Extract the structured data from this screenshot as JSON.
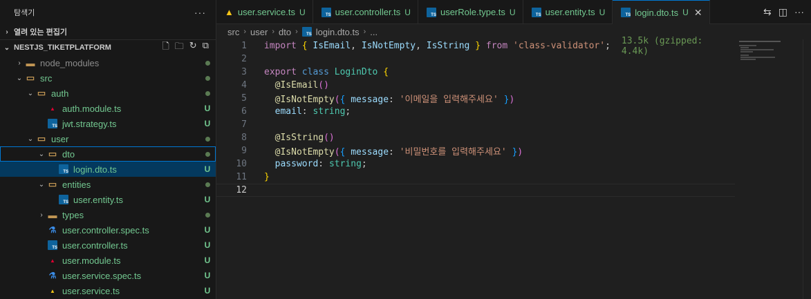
{
  "sidebar": {
    "title": "탐색기",
    "more": "···",
    "open_editors": "열려 있는 편집기",
    "project": "NESTJS_TIKETPLATFORM",
    "tree": [
      {
        "label": "node_modules",
        "indent": 0,
        "chev": "›",
        "icon": "folder",
        "status": "dot"
      },
      {
        "label": "src",
        "indent": 0,
        "chev": "⌄",
        "icon": "folder-open",
        "status": "dot"
      },
      {
        "label": "auth",
        "indent": 1,
        "chev": "⌄",
        "icon": "folder-open",
        "status": "dot"
      },
      {
        "label": "auth.module.ts",
        "indent": 2,
        "chev": "",
        "icon": "angular",
        "status": "U"
      },
      {
        "label": "jwt.strategy.ts",
        "indent": 2,
        "chev": "",
        "icon": "ts",
        "status": "U"
      },
      {
        "label": "user",
        "indent": 1,
        "chev": "⌄",
        "icon": "folder-open",
        "status": "dot"
      },
      {
        "label": "dto",
        "indent": 2,
        "chev": "⌄",
        "icon": "folder-open",
        "status": "dot"
      },
      {
        "label": "login.dto.ts",
        "indent": 3,
        "chev": "",
        "icon": "ts",
        "status": "U"
      },
      {
        "label": "entities",
        "indent": 2,
        "chev": "⌄",
        "icon": "folder-open",
        "status": "dot"
      },
      {
        "label": "user.entity.ts",
        "indent": 3,
        "chev": "",
        "icon": "ts",
        "status": "U"
      },
      {
        "label": "types",
        "indent": 2,
        "chev": "›",
        "icon": "folder",
        "status": "dot"
      },
      {
        "label": "user.controller.spec.ts",
        "indent": 2,
        "chev": "",
        "icon": "test",
        "status": "U"
      },
      {
        "label": "user.controller.ts",
        "indent": 2,
        "chev": "",
        "icon": "ts",
        "status": "U"
      },
      {
        "label": "user.module.ts",
        "indent": 2,
        "chev": "",
        "icon": "angular",
        "status": "U"
      },
      {
        "label": "user.service.spec.ts",
        "indent": 2,
        "chev": "",
        "icon": "test",
        "status": "U"
      },
      {
        "label": "user.service.ts",
        "indent": 2,
        "chev": "",
        "icon": "angular-yellow",
        "status": "U"
      }
    ]
  },
  "tabs": [
    {
      "label": "user.service.ts",
      "status": "U",
      "icon": "angular-yellow"
    },
    {
      "label": "user.controller.ts",
      "status": "U",
      "icon": "ts"
    },
    {
      "label": "userRole.type.ts",
      "status": "U",
      "icon": "ts"
    },
    {
      "label": "user.entity.ts",
      "status": "U",
      "icon": "ts"
    },
    {
      "label": "login.dto.ts",
      "status": "U",
      "icon": "ts",
      "active": true
    }
  ],
  "breadcrumb": [
    "src",
    "user",
    "dto",
    "login.dto.ts",
    "..."
  ],
  "code": {
    "hint": "13.5k (gzipped: 4.4k)",
    "line_numbers": [
      "1",
      "2",
      "3",
      "4",
      "5",
      "6",
      "7",
      "8",
      "9",
      "10",
      "11",
      "12"
    ],
    "strings": {
      "import_from": "'class-validator'",
      "msg_email": "'이메일을 입력해주세요'",
      "msg_password": "'비밀번호를 입력해주세요'"
    }
  }
}
